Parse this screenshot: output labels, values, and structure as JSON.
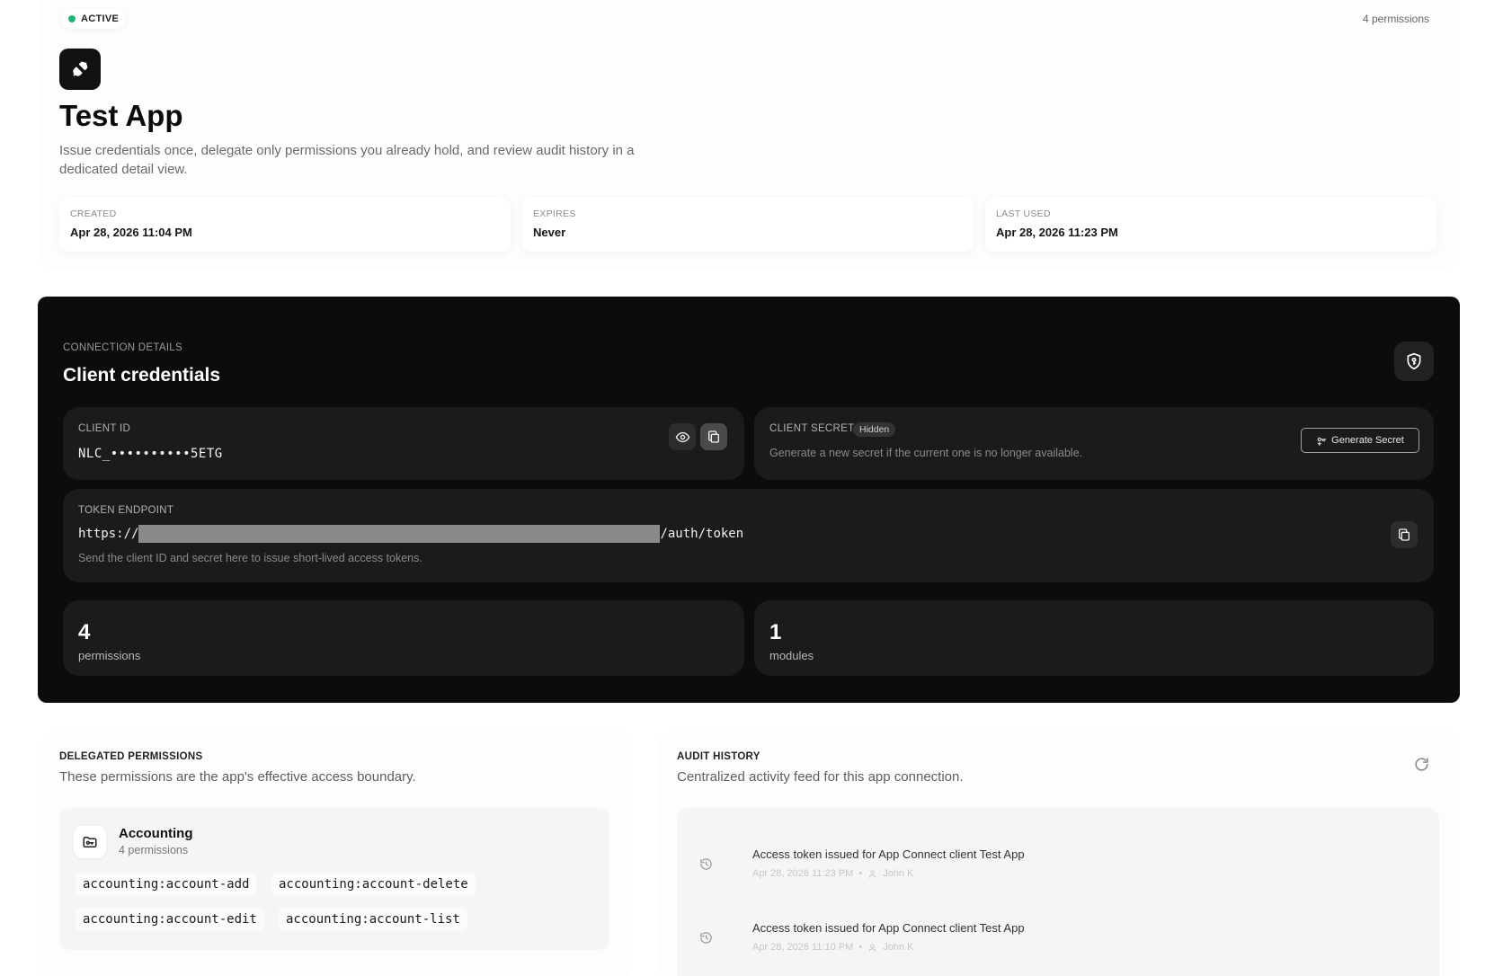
{
  "header": {
    "status": "ACTIVE",
    "permissions_count_label": "4 permissions",
    "app_title": "Test App",
    "description": "Issue credentials once, delegate only permissions you already hold, and review audit history in a dedicated detail view.",
    "meta": [
      {
        "label": "CREATED",
        "value": "Apr 28, 2026 11:04 PM"
      },
      {
        "label": "EXPIRES",
        "value": "Never"
      },
      {
        "label": "LAST USED",
        "value": "Apr 28, 2026 11:23 PM"
      }
    ]
  },
  "connection": {
    "kicker": "CONNECTION DETAILS",
    "title": "Client credentials",
    "client_id": {
      "label": "CLIENT ID",
      "value": "NLC_••••••••••5ETG"
    },
    "client_secret": {
      "label": "CLIENT SECRET",
      "badge": "Hidden",
      "hint": "Generate a new secret if the current one is no longer available.",
      "button": "Generate Secret"
    },
    "token_endpoint": {
      "label": "TOKEN ENDPOINT",
      "prefix": "https://",
      "suffix": "/auth/token",
      "hint": "Send the client ID and secret here to issue short-lived access tokens."
    },
    "stats": [
      {
        "value": "4",
        "label": "permissions"
      },
      {
        "value": "1",
        "label": "modules"
      }
    ]
  },
  "delegated": {
    "kicker": "DELEGATED PERMISSIONS",
    "subtitle": "These permissions are the app's effective access boundary.",
    "module": {
      "name": "Accounting",
      "count": "4 permissions",
      "permissions": [
        "accounting:account-add",
        "accounting:account-delete",
        "accounting:account-edit",
        "accounting:account-list"
      ]
    }
  },
  "audit": {
    "kicker": "AUDIT HISTORY",
    "subtitle": "Centralized activity feed for this app connection.",
    "items": [
      {
        "text": "Access token issued for App Connect client Test App",
        "time": "Apr 28, 2026 11:23 PM",
        "user": "John K"
      },
      {
        "text": "Access token issued for App Connect client Test App",
        "time": "Apr 28, 2026 11:10 PM",
        "user": "John K"
      }
    ]
  },
  "colors": {
    "status_active": "#22b573",
    "panel_dark": "#0c0c0c",
    "card_dark": "#1b1b1b"
  },
  "icons": [
    "plug-icon",
    "shield-key-icon",
    "eye-icon",
    "copy-icon",
    "key-plus-icon",
    "refresh-icon",
    "folder-key-icon",
    "history-icon",
    "user-icon"
  ]
}
